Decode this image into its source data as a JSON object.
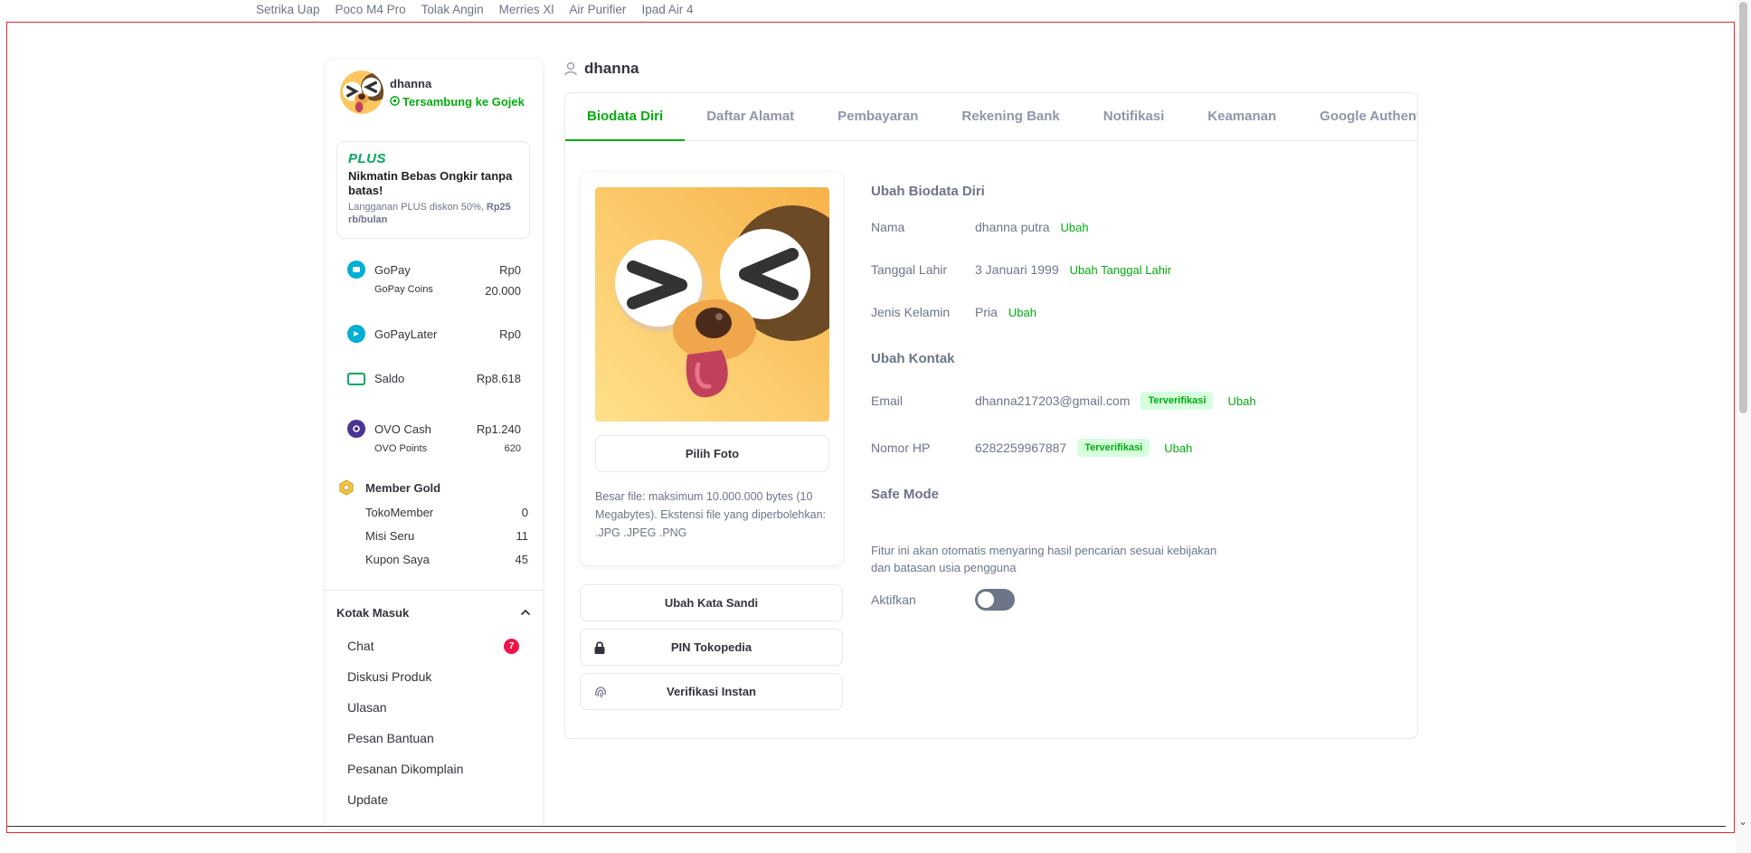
{
  "top_links": [
    "Setrika Uap",
    "Poco M4 Pro",
    "Tolak Angin",
    "Merries Xl",
    "Air Purifier",
    "Ipad Air 4"
  ],
  "sidebar": {
    "username": "dhanna",
    "gojek_status": "Tersambung ke Gojek",
    "plus": {
      "logo": "PLUS",
      "title": "Nikmatin Bebas Ongkir tanpa batas!",
      "desc_prefix": "Langganan PLUS diskon 50%, ",
      "desc_price": "Rp25 rb/bulan"
    },
    "wallets": {
      "gopay": {
        "label": "GoPay",
        "value": "Rp0",
        "sub_label": "GoPay Coins",
        "sub_value": "20.000"
      },
      "gopaylater": {
        "label": "GoPayLater",
        "value": "Rp0"
      },
      "saldo": {
        "label": "Saldo",
        "value": "Rp8.618"
      },
      "ovo": {
        "label": "OVO Cash",
        "value": "Rp1.240",
        "sub_label": "OVO Points",
        "sub_value": "620"
      }
    },
    "member": {
      "title": "Member Gold",
      "rows": [
        {
          "label": "TokoMember",
          "value": "0"
        },
        {
          "label": "Misi Seru",
          "value": "11"
        },
        {
          "label": "Kupon Saya",
          "value": "45"
        }
      ]
    },
    "inbox": {
      "title": "Kotak Masuk",
      "items": [
        {
          "label": "Chat",
          "badge": "7"
        },
        {
          "label": "Diskusi Produk"
        },
        {
          "label": "Ulasan"
        },
        {
          "label": "Pesan Bantuan"
        },
        {
          "label": "Pesanan Dikomplain"
        },
        {
          "label": "Update"
        }
      ]
    }
  },
  "main": {
    "title": "dhanna",
    "tabs": [
      "Biodata Diri",
      "Daftar Alamat",
      "Pembayaran",
      "Rekening Bank",
      "Notifikasi",
      "Keamanan",
      "Google Authenticator"
    ],
    "active_tab": "Biodata Diri",
    "photo_button": "Pilih Foto",
    "photo_hint": "Besar file: maksimum 10.000.000 bytes (10 Megabytes). Ekstensi file yang diperbolehkan: .JPG .JPEG .PNG",
    "change_password": "Ubah Kata Sandi",
    "pin": "PIN Tokopedia",
    "instant_verify": "Verifikasi Instan",
    "biodata": {
      "title": "Ubah Biodata Diri",
      "name_label": "Nama",
      "name_value": "dhanna putra",
      "name_action": "Ubah",
      "dob_label": "Tanggal Lahir",
      "dob_value": "3 Januari 1999",
      "dob_action": "Ubah Tanggal Lahir",
      "gender_label": "Jenis Kelamin",
      "gender_value": "Pria",
      "gender_action": "Ubah"
    },
    "contact": {
      "title": "Ubah Kontak",
      "email_label": "Email",
      "email_value": "dhanna217203@gmail.com",
      "email_badge": "Terverifikasi",
      "email_action": "Ubah",
      "phone_label": "Nomor HP",
      "phone_value": "6282259967887",
      "phone_badge": "Terverifikasi",
      "phone_action": "Ubah"
    },
    "safe_mode": {
      "title": "Safe Mode",
      "desc_line1": "Fitur ini akan otomatis menyaring hasil pencarian sesuai kebijakan",
      "desc_line2": "dan batasan usia pengguna",
      "toggle_label": "Aktifkan",
      "enabled": false
    }
  },
  "colors": {
    "brand_green": "#03ac0e",
    "badge_red": "#ef144a",
    "text": "#31353b",
    "muted": "#6d7588",
    "highlight_border": "#e0262f"
  }
}
